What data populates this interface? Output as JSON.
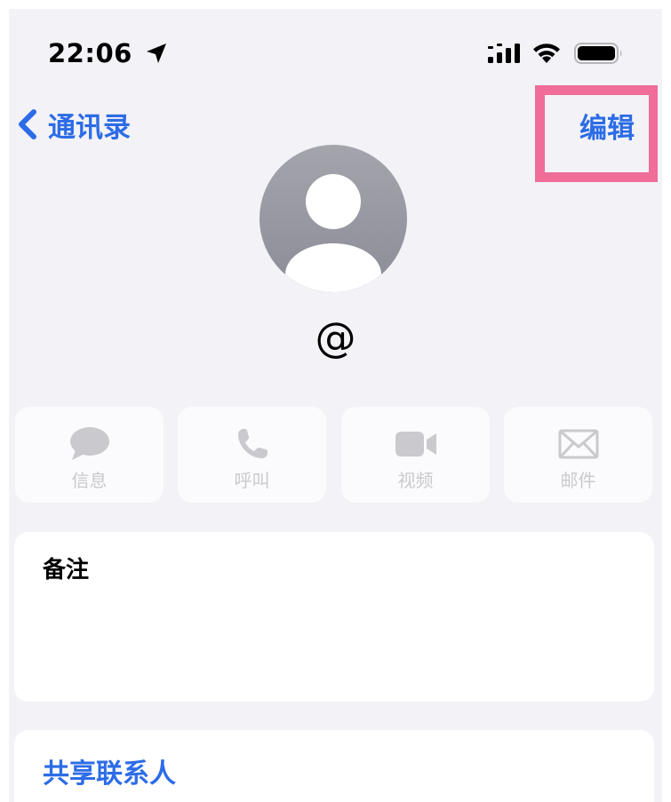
{
  "status_bar": {
    "time": "22:06"
  },
  "nav": {
    "back_label": "通讯录",
    "edit_label": "编辑"
  },
  "contact": {
    "name": "@"
  },
  "actions": [
    {
      "label": "信息",
      "icon": "message-bubble-icon"
    },
    {
      "label": "呼叫",
      "icon": "phone-icon"
    },
    {
      "label": "视频",
      "icon": "video-camera-icon"
    },
    {
      "label": "邮件",
      "icon": "envelope-icon"
    }
  ],
  "notes": {
    "label": "备注"
  },
  "share": {
    "label": "共享联系人"
  },
  "colors": {
    "accent": "#2c6ce6",
    "highlight": "#ef6d98",
    "background": "#f2f2f7",
    "disabled": "#c9c9ce"
  }
}
